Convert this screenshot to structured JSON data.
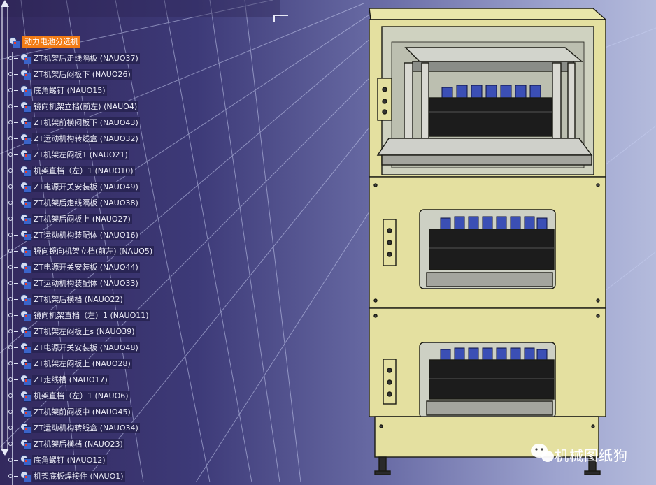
{
  "tree": {
    "root": "动力电池分选机",
    "items": [
      "ZT机架后走线隔板 (NAUO37)",
      "ZT机架后闷板下 (NAUO26)",
      "底角螺钉 (NAUO15)",
      "镜向机架立档(前左) (NAUO4)",
      "ZT机架前横闷板下 (NAUO43)",
      "ZT运动机构转线盒 (NAUO32)",
      "ZT机架左闷板1 (NAUO21)",
      "机架直档（左）1 (NAUO10)",
      "ZT电源开关安装板 (NAUO49)",
      "ZT机架后走线隔板 (NAUO38)",
      "ZT机架后闷板上 (NAUO27)",
      "ZT运动机构装配体 (NAUO16)",
      "镜向镜向机架立档(前左) (NAUO5)",
      "ZT电源开关安装板 (NAUO44)",
      "ZT运动机构装配体 (NAUO33)",
      "ZT机架后横档 (NAUO22)",
      "镜向机架直档（左）1 (NAUO11)",
      "ZT机架左闷板上s (NAUO39)",
      "ZT电源开关安装板 (NAUO48)",
      "ZT机架左闷板上 (NAUO28)",
      "ZT走线槽 (NAUO17)",
      "机架直档（左）1 (NAUO6)",
      "ZT机架前闷板中 (NAUO45)",
      "ZT运动机构转线盒 (NAUO34)",
      "ZT机架后横档 (NAUO23)",
      "底角螺钉 (NAUO12)",
      "机架底板焊接件 (NAUO1)"
    ]
  },
  "watermark": "机械图纸狗",
  "colors": {
    "root_highlight": "#f27c16",
    "frame_yellow": "#e6e2a2",
    "background_dark": "#33295e",
    "background_light": "#b4bbdc"
  }
}
